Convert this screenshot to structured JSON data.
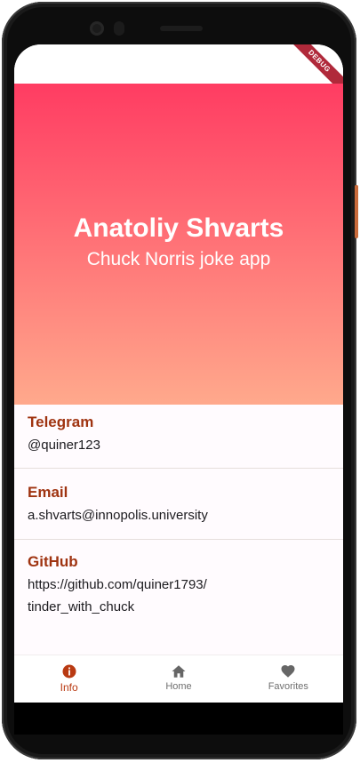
{
  "debug_banner": "DEBUG",
  "header": {
    "name": "Anatoliy Shvarts",
    "subtitle": "Chuck Norris joke app"
  },
  "contacts": [
    {
      "label": "Telegram",
      "value": "@quiner123"
    },
    {
      "label": "Email",
      "value": "a.shvarts@innopolis.university"
    },
    {
      "label": "GitHub",
      "value_line1": "https://github.com/quiner1793/",
      "value_line2": "tinder_with_chuck"
    }
  ],
  "nav": {
    "info": "Info",
    "home": "Home",
    "favorites": "Favorites"
  },
  "colors": {
    "gradient_top": "#ff3c62",
    "gradient_bottom": "#ffa98c",
    "label": "#9f3310",
    "active_nav": "#b93a12"
  },
  "icons": {
    "info": "info-icon",
    "home": "home-icon",
    "favorites": "heart-icon"
  }
}
